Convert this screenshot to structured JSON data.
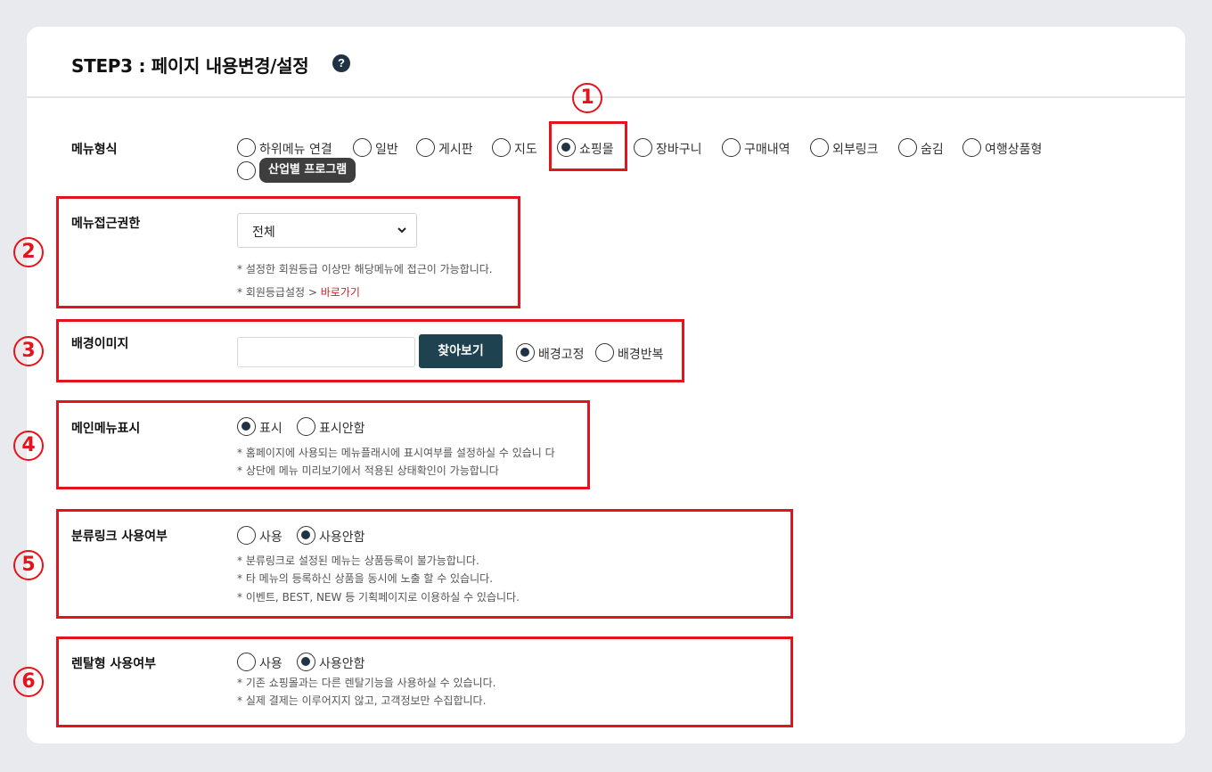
{
  "header": {
    "title": "STEP3 : 페이지 내용변경/설정",
    "help_glyph": "?"
  },
  "annotations": [
    "1",
    "2",
    "3",
    "4",
    "5",
    "6"
  ],
  "menu_type": {
    "label": "메뉴형식",
    "options": [
      "하위메뉴 연결",
      "일반",
      "게시판",
      "지도",
      "쇼핑몰",
      "장바구니",
      "구매내역",
      "외부링크",
      "숨김",
      "여행상품형",
      ""
    ],
    "selected": "쇼핑몰",
    "tooltip": "산업별 프로그램"
  },
  "access": {
    "label": "메뉴접근권한",
    "select_value": "전체",
    "note1": "* 설정한 회원등급 이상만 해당메뉴에 접근이 가능합니다.",
    "note2_prefix": "* 회원등급설정 > ",
    "note2_link": "바로가기"
  },
  "background": {
    "label": "배경이미지",
    "input_value": "",
    "browse_label": "찾아보기",
    "options": [
      "배경고정",
      "배경반복"
    ],
    "selected": "배경고정"
  },
  "main_menu": {
    "label": "메인메뉴표시",
    "options": [
      "표시",
      "표시안함"
    ],
    "selected": "표시",
    "notes": [
      "* 홈페이지에 사용되는 메뉴플래시에 표시여부를 설정하실 수 있습니 다",
      "* 상단에 메뉴 미리보기에서 적용된 상태확인이 가능합니다"
    ]
  },
  "category_link": {
    "label": "분류링크 사용여부",
    "options": [
      "사용",
      "사용안함"
    ],
    "selected": "사용안함",
    "notes": [
      "* 분류링크로 설정된 메뉴는 상품등록이 불가능합니다.",
      "* 타 메뉴의 등록하신 상품을 동시에 노출 할 수 있습니다.",
      "* 이벤트, BEST, NEW 등 기획페이지로 이용하실 수 있습니다."
    ]
  },
  "rental": {
    "label": "렌탈형 사용여부",
    "options": [
      "사용",
      "사용안함"
    ],
    "selected": "사용안함",
    "notes": [
      "* 기존 쇼핑몰과는 다른 렌탈기능을 사용하실 수 있습니다.",
      "* 실제 결제는 이루어지지 않고, 고객정보만 수집합니다."
    ]
  },
  "colors": {
    "accent": "#1f3344",
    "button": "#1f4251",
    "annotation_red": "#e3141b",
    "link_red": "#c4262c"
  }
}
